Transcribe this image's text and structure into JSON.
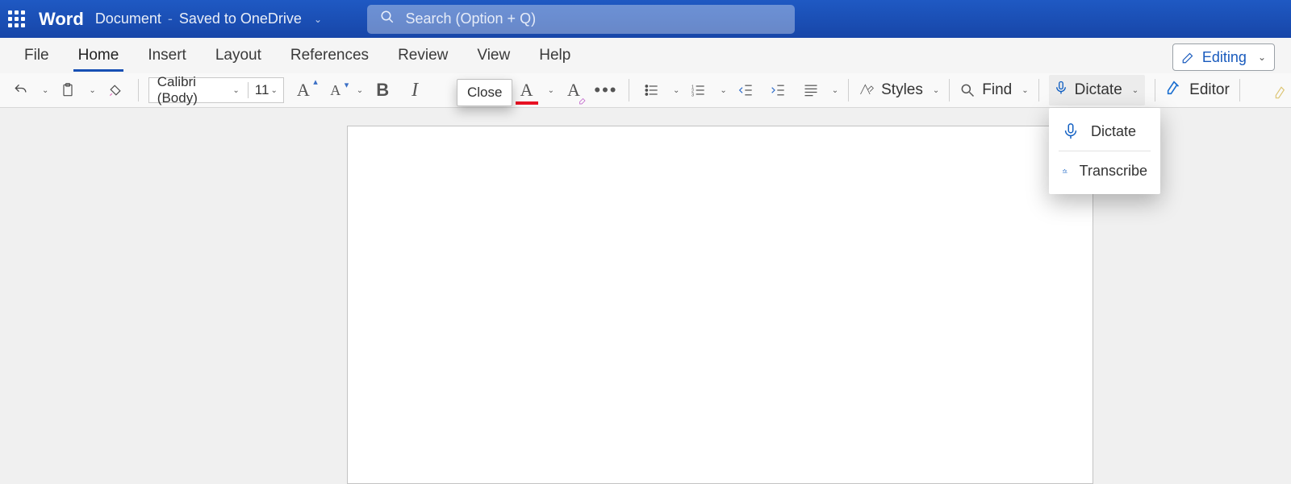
{
  "title": {
    "app": "Word",
    "document": "Document",
    "save_state": "Saved to OneDrive"
  },
  "search": {
    "placeholder": "Search (Option + Q)"
  },
  "mode": {
    "label": "Editing"
  },
  "tabs": [
    "File",
    "Home",
    "Insert",
    "Layout",
    "References",
    "Review",
    "View",
    "Help"
  ],
  "active_tab_index": 1,
  "ribbon": {
    "font_name": "Calibri (Body)",
    "font_size": "11",
    "styles_label": "Styles",
    "find_label": "Find",
    "dictate_label": "Dictate",
    "editor_label": "Editor"
  },
  "tooltip": {
    "close": "Close"
  },
  "dictate_menu": {
    "dictate": "Dictate",
    "transcribe": "Transcribe"
  }
}
